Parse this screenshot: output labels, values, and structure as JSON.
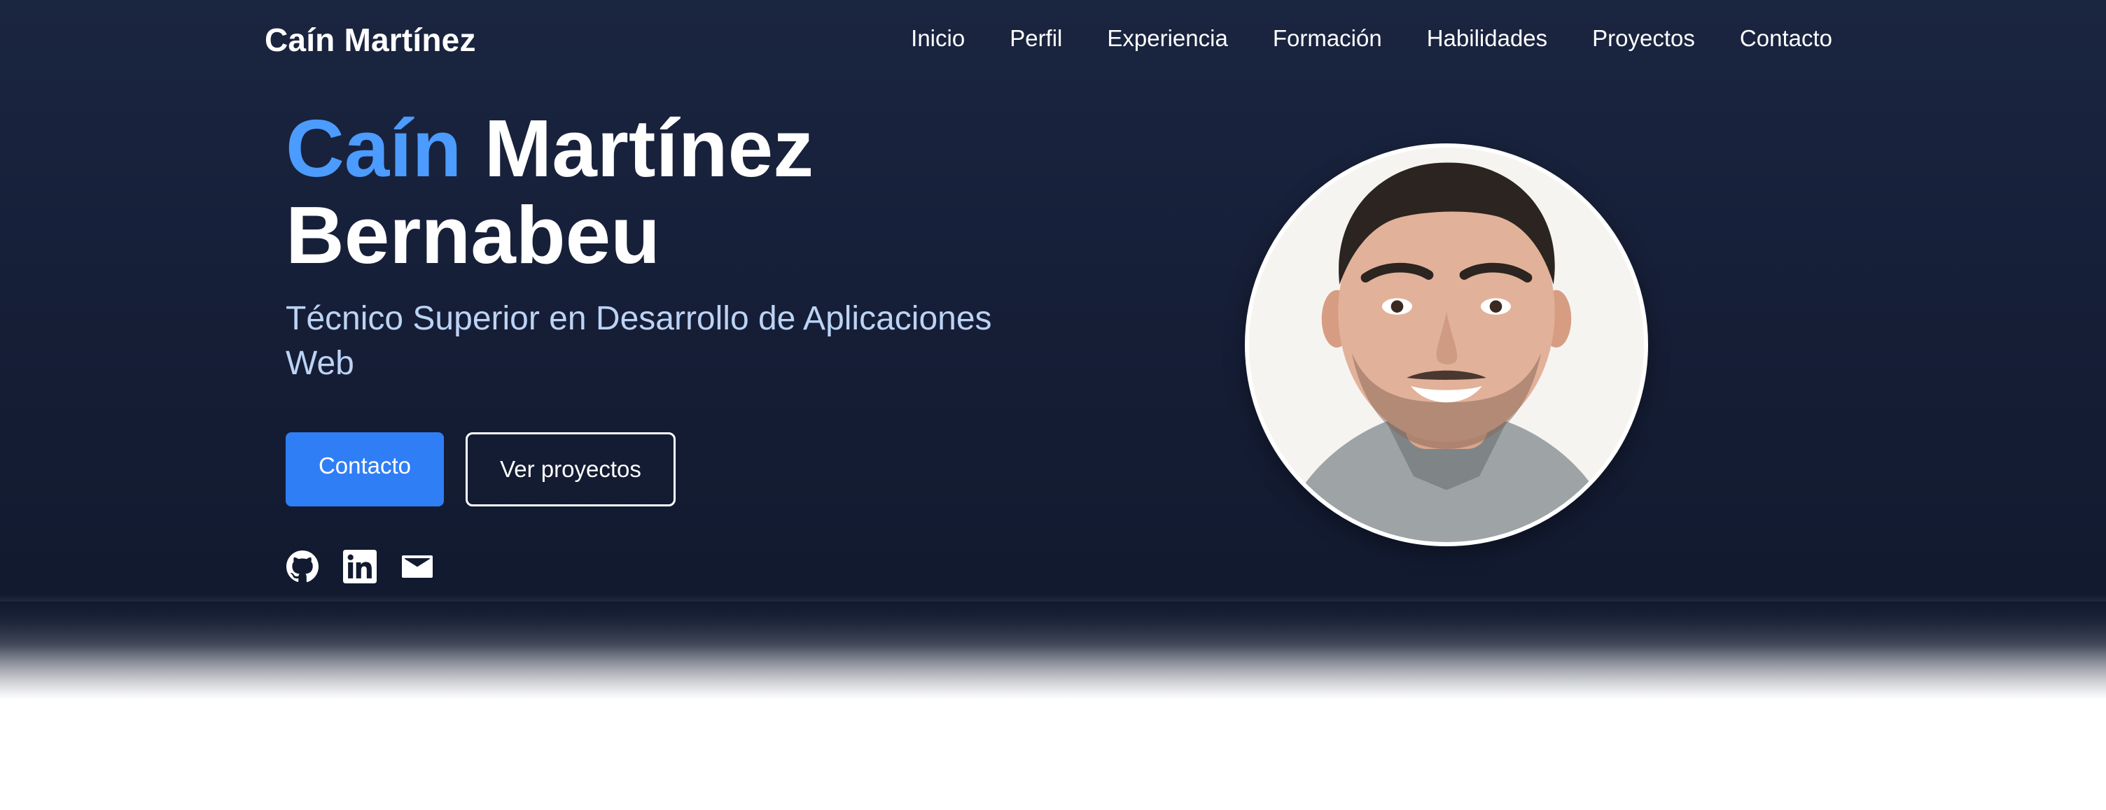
{
  "nav": {
    "brand": "Caín Martínez",
    "links": [
      {
        "label": "Inicio"
      },
      {
        "label": "Perfil"
      },
      {
        "label": "Experiencia"
      },
      {
        "label": "Formación"
      },
      {
        "label": "Habilidades"
      },
      {
        "label": "Proyectos"
      },
      {
        "label": "Contacto"
      }
    ]
  },
  "hero": {
    "name_first": "Caín",
    "name_rest": "Martínez",
    "name_last": "Bernabeu",
    "subtitle": "Técnico Superior en Desarrollo de Aplicaciones Web",
    "cta_primary": "Contacto",
    "cta_secondary": "Ver proyectos",
    "social": [
      {
        "icon": "github-icon"
      },
      {
        "icon": "linkedin-icon"
      },
      {
        "icon": "mail-icon"
      }
    ]
  },
  "colors": {
    "hero_bg": "#151d35",
    "accent": "#4c9bff",
    "primary_button": "#2f7ef6",
    "subtitle": "#bcd3f5",
    "text": "#ffffff"
  }
}
